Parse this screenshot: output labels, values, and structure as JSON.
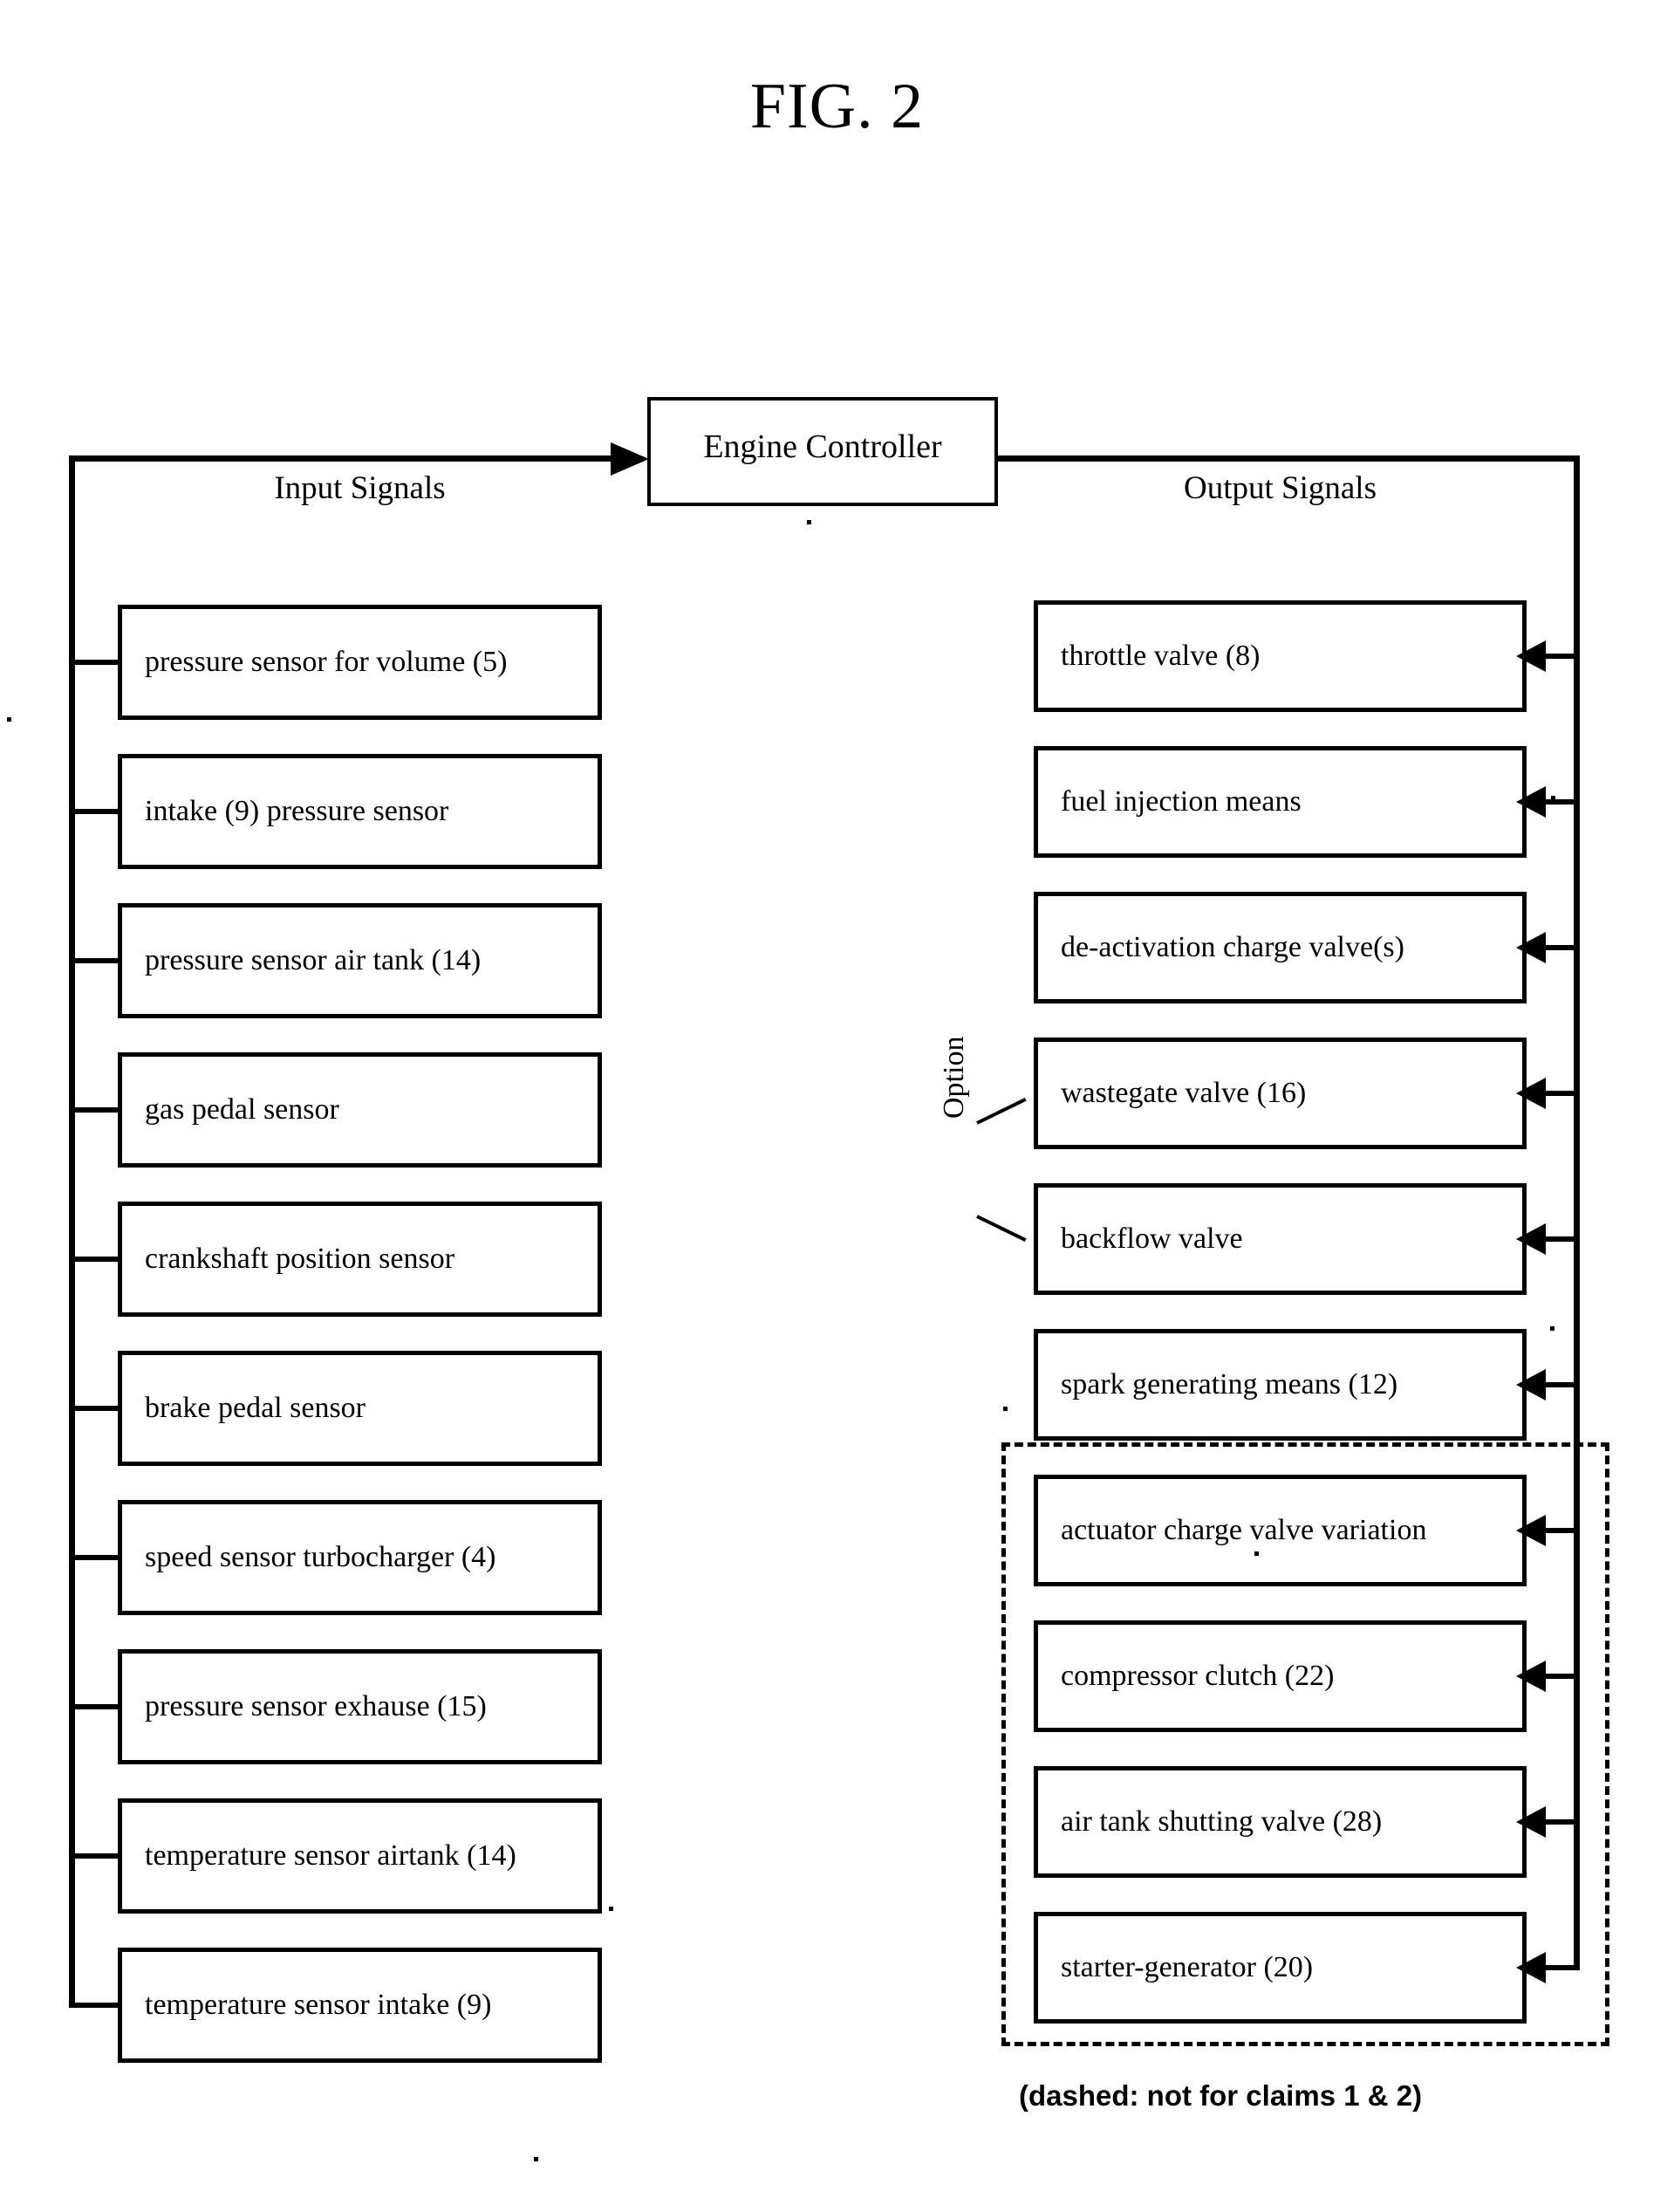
{
  "figure": {
    "title": "FIG. 2",
    "controller": {
      "label": "Engine Controller"
    },
    "input_column": {
      "heading": "Input Signals"
    },
    "output_column": {
      "heading": "Output Signals"
    },
    "option_label": "Option",
    "dashed_caption": "(dashed: not for claims 1 & 2)",
    "colors": {
      "ink": "#000000",
      "paper": "#ffffff"
    }
  },
  "input_signals": [
    {
      "label": "pressure sensor for volume (5)"
    },
    {
      "label": "intake (9) pressure sensor"
    },
    {
      "label": "pressure sensor air tank (14)"
    },
    {
      "label": "gas pedal sensor"
    },
    {
      "label": "crankshaft position sensor"
    },
    {
      "label": "brake pedal sensor"
    },
    {
      "label": "speed sensor turbocharger (4)"
    },
    {
      "label": "pressure sensor exhause (15)"
    },
    {
      "label": "temperature sensor airtank (14)"
    },
    {
      "label": "temperature sensor intake (9)"
    }
  ],
  "output_signals": [
    {
      "label": "throttle valve (8)"
    },
    {
      "label": "fuel injection means"
    },
    {
      "label": "de-activation charge valve(s)"
    },
    {
      "label": "wastegate valve (16)"
    },
    {
      "label": "backflow valve"
    },
    {
      "label": "spark generating means (12)"
    },
    {
      "label": "actuator charge valve variation"
    },
    {
      "label": "compressor clutch (22)"
    },
    {
      "label": "air tank shutting valve (28)"
    },
    {
      "label": "starter-generator (20)"
    }
  ]
}
